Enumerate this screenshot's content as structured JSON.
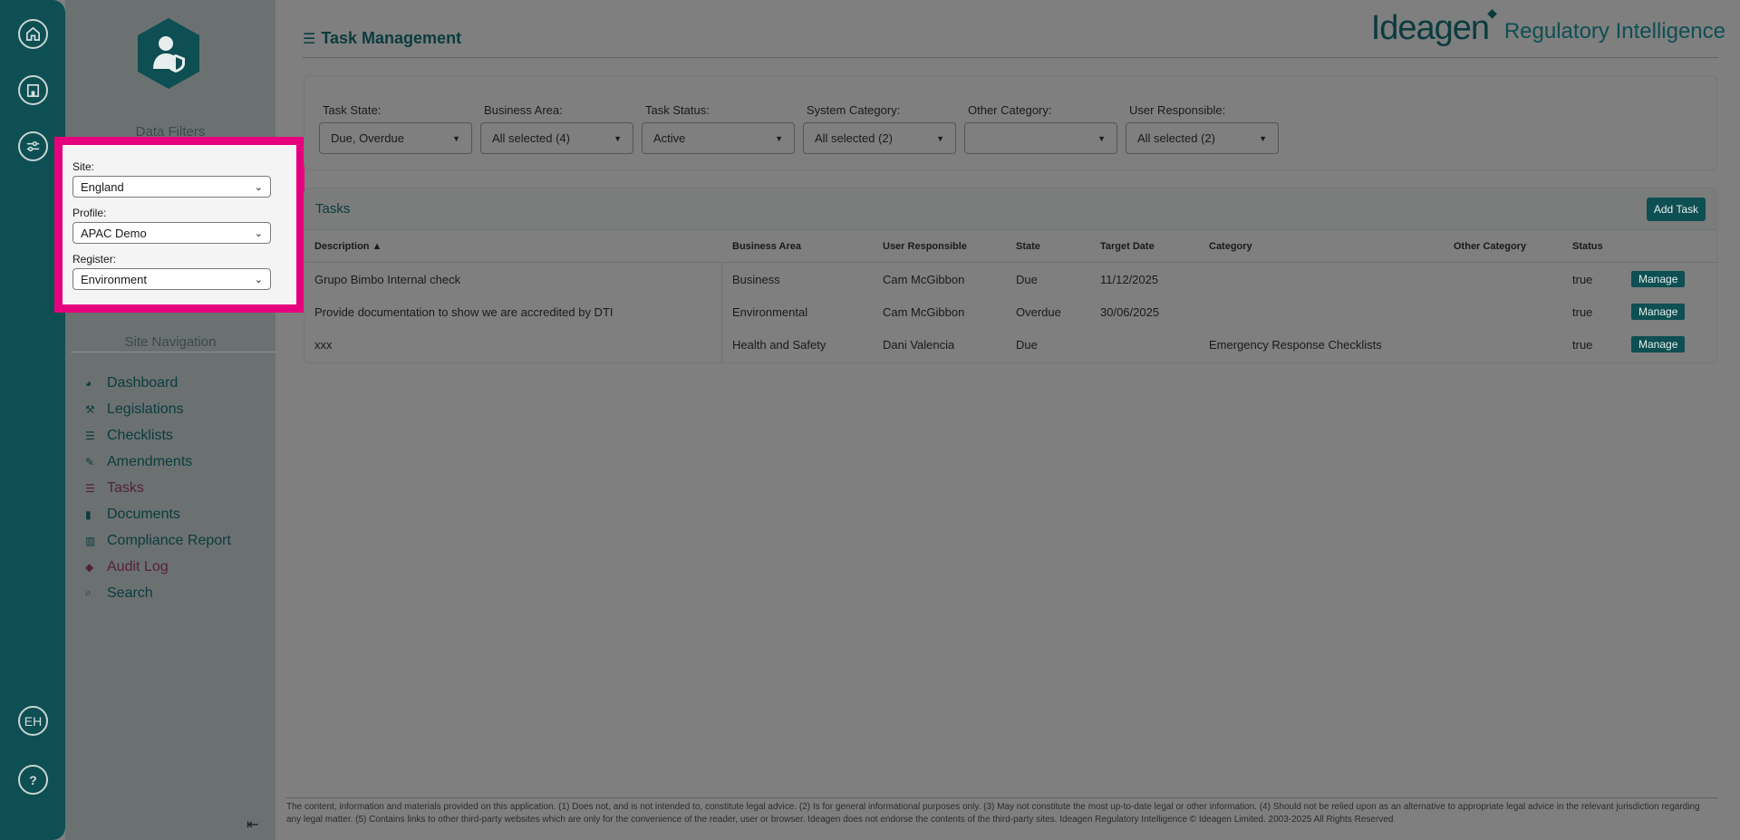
{
  "rail": {
    "icons": [
      "home-icon",
      "building-icon",
      "sliders-icon"
    ],
    "user_initials": "EH",
    "help_label": "?"
  },
  "sidebar": {
    "data_filters_heading": "Data Filters",
    "site_label": "Site:",
    "site_value": "England",
    "profile_label": "Profile:",
    "profile_value": "APAC Demo",
    "register_label": "Register:",
    "register_value": "Environment",
    "site_navigation_heading": "Site Navigation",
    "nav": [
      {
        "label": "Dashboard",
        "icon": "dashboard-icon"
      },
      {
        "label": "Legislations",
        "icon": "gavel-icon"
      },
      {
        "label": "Checklists",
        "icon": "list-icon"
      },
      {
        "label": "Amendments",
        "icon": "edit-icon"
      },
      {
        "label": "Tasks",
        "icon": "tasks-icon"
      },
      {
        "label": "Documents",
        "icon": "document-icon"
      },
      {
        "label": "Compliance Report",
        "icon": "chart-icon"
      },
      {
        "label": "Audit Log",
        "icon": "tags-icon"
      },
      {
        "label": "Search",
        "icon": "search-icon"
      }
    ],
    "collapse_glyph": "⇤"
  },
  "header": {
    "title": "Task Management",
    "brand_name": "Ideagen",
    "brand_sub": "Regulatory Intelligence"
  },
  "filters": [
    {
      "label": "Task State:",
      "value": "Due, Overdue"
    },
    {
      "label": "Business Area:",
      "value": "All selected (4)"
    },
    {
      "label": "Task Status:",
      "value": "Active"
    },
    {
      "label": "System Category:",
      "value": "All selected (2)"
    },
    {
      "label": "Other Category:",
      "value": ""
    },
    {
      "label": "User Responsible:",
      "value": "All selected (2)"
    }
  ],
  "tasks": {
    "title": "Tasks",
    "add_label": "Add Task",
    "columns": [
      "Description ▲",
      "Business Area",
      "User Responsible",
      "State",
      "Target Date",
      "Category",
      "Other Category",
      "Status"
    ],
    "rows": [
      {
        "description": "Grupo Bimbo Internal check",
        "business_area": "Business",
        "user": "Cam McGibbon",
        "state": "Due",
        "target_date": "11/12/2025",
        "category": "",
        "other_category": "",
        "status": "true",
        "action": "Manage"
      },
      {
        "description": "Provide documentation to show we are accredited by DTI",
        "business_area": "Environmental",
        "user": "Cam McGibbon",
        "state": "Overdue",
        "target_date": "30/06/2025",
        "category": "",
        "other_category": "",
        "status": "true",
        "action": "Manage"
      },
      {
        "description": "xxx",
        "business_area": "Health and Safety",
        "user": "Dani Valencia",
        "state": "Due",
        "target_date": "",
        "category": "Emergency Response Checklists",
        "other_category": "",
        "status": "true",
        "action": "Manage"
      }
    ]
  },
  "footer": {
    "text": "The content, information and materials provided on this application. (1) Does not, and is not intended to, constitute legal advice. (2) Is for general informational purposes only. (3) May not constitute the most up-to-date legal or other information. (4) Should not be relied upon as an alternative to appropriate legal advice in the relevant jurisdiction regarding any legal matter. (5) Contains links to other third-party websites which are only for the convenience of the reader, user or browser. Ideagen does not endorse the contents of the third-party sites. Ideagen Regulatory Intelligence © Ideagen Limited. 2003-2025 All Rights Reserved"
  },
  "colors": {
    "teal": "#0d4f52",
    "highlight": "#e6007e"
  }
}
